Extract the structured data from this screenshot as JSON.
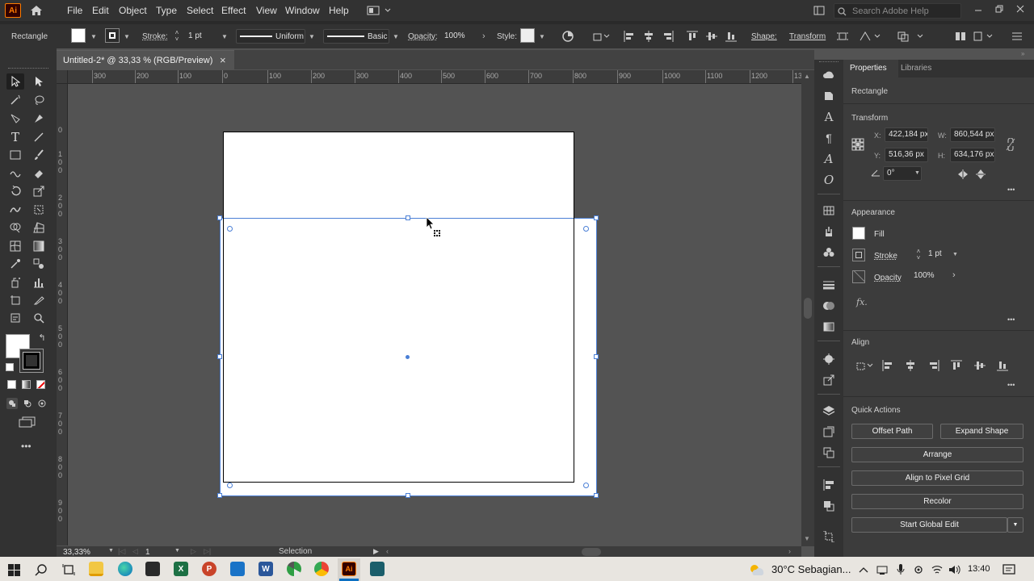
{
  "menubar": {
    "app_badge": "Ai",
    "menus": [
      "File",
      "Edit",
      "Object",
      "Type",
      "Select",
      "Effect",
      "View",
      "Window",
      "Help"
    ],
    "search_placeholder": "Search Adobe Help"
  },
  "control": {
    "object_label": "Rectangle",
    "stroke_label": "Stroke:",
    "stroke_value": "1 pt",
    "stroke_profile": "Uniform",
    "brush": "Basic",
    "opacity_label": "Opacity:",
    "opacity_value": "100%",
    "style_label": "Style:",
    "shape_label": "Shape:",
    "transform_label": "Transform"
  },
  "doc": {
    "tab_title": "Untitled-2* @ 33,33 % (RGB/Preview)",
    "close": "×"
  },
  "ruler": {
    "h": [
      "300",
      "200",
      "100",
      "0",
      "100",
      "200",
      "300",
      "400",
      "500",
      "600",
      "700",
      "800",
      "900",
      "1000",
      "1100",
      "1200",
      "13"
    ],
    "v": [
      "0",
      "1\n0\n0",
      "2\n0\n0",
      "3\n0\n0",
      "4\n0\n0",
      "5\n0\n0",
      "6\n0\n0",
      "7\n0\n0",
      "8\n0\n0",
      "9\n0\n0"
    ]
  },
  "status": {
    "zoom": "33,33%",
    "artboard": "1",
    "mode": "Selection"
  },
  "panel": {
    "tab_properties": "Properties",
    "tab_libraries": "Libraries",
    "object_type": "Rectangle",
    "transform_title": "Transform",
    "x_label": "X:",
    "x_value": "422,184 px",
    "y_label": "Y:",
    "y_value": "516,36 px",
    "w_label": "W:",
    "w_value": "860,544 px",
    "h_label": "H:",
    "h_value": "634,176 px",
    "angle_value": "0°",
    "appearance_title": "Appearance",
    "fill_label": "Fill",
    "stroke_label": "Stroke",
    "stroke_value": "1 pt",
    "opacity_label": "Opacity",
    "opacity_value": "100%",
    "fx": "fx.",
    "align_title": "Align",
    "quick_title": "Quick Actions",
    "btn_offset": "Offset Path",
    "btn_expand": "Expand Shape",
    "btn_arrange": "Arrange",
    "btn_pixel": "Align to Pixel Grid",
    "btn_recolor": "Recolor",
    "btn_global": "Start Global Edit",
    "more": "•••"
  },
  "taskbar": {
    "weather": "30°C  Sebagian...",
    "time": "13:40"
  },
  "colors": {
    "ui_dark": "#323232",
    "panel": "#3c3c3c",
    "canvas": "#535353",
    "selection": "#4a7fd6",
    "ai_orange": "#ff7c00",
    "ai_bg": "#330000"
  }
}
